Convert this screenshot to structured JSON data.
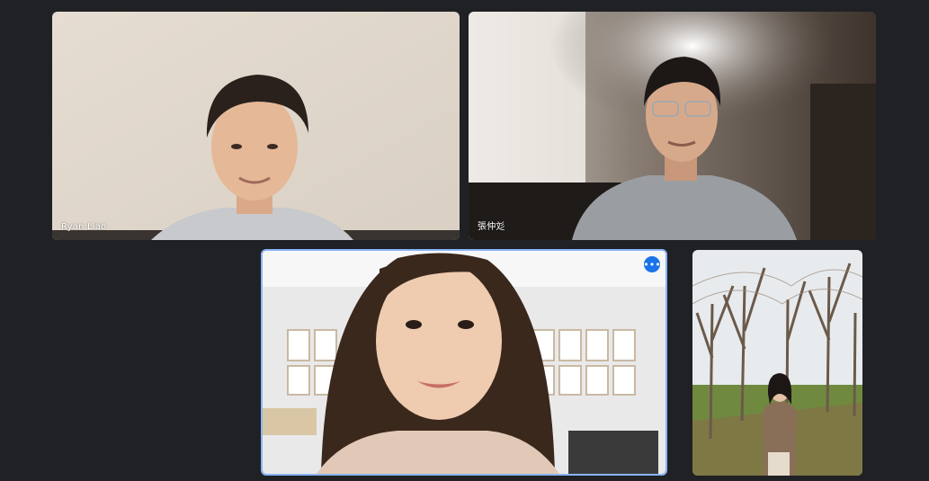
{
  "participants": [
    {
      "name": "Ryan Liao"
    },
    {
      "name": "張仲彣"
    },
    {
      "name": "",
      "options_icon": "more-options-icon",
      "active_border_color": "#8ab4f8"
    },
    {
      "name": ""
    }
  ],
  "more_options_glyph": "•••",
  "colors": {
    "background": "#202124",
    "accent": "#1a73e8"
  }
}
